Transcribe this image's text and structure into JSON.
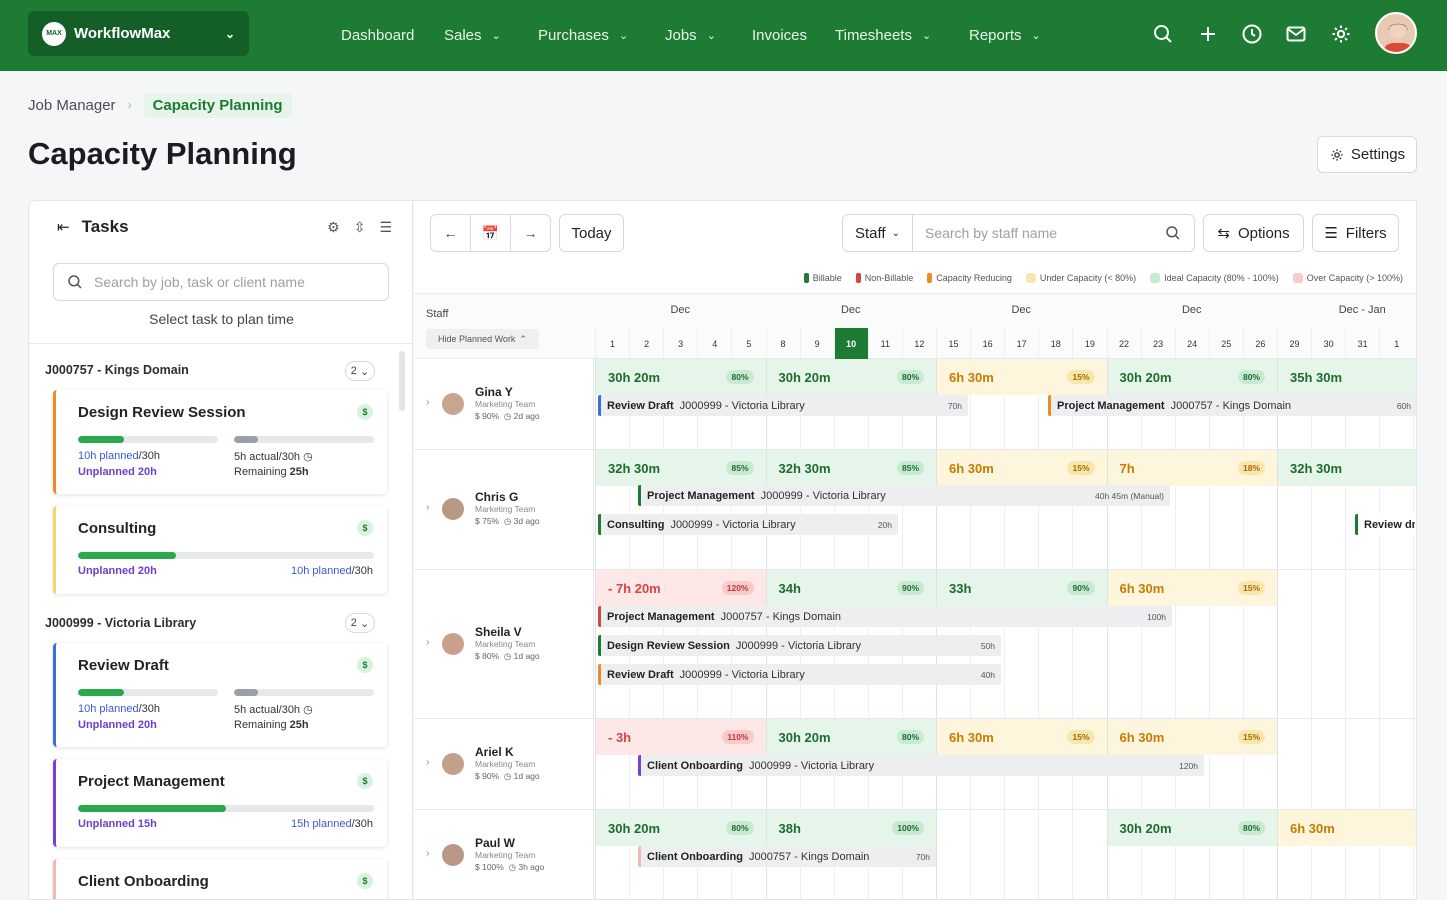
{
  "app": {
    "name": "WorkflowMax",
    "logo": "MAX"
  },
  "nav": [
    {
      "label": "Dashboard",
      "dd": false
    },
    {
      "label": "Sales",
      "dd": true
    },
    {
      "label": "Purchases",
      "dd": true
    },
    {
      "label": "Jobs",
      "dd": true
    },
    {
      "label": "Invoices",
      "dd": false
    },
    {
      "label": "Timesheets",
      "dd": true
    },
    {
      "label": "Reports",
      "dd": true
    }
  ],
  "breadcrumb": {
    "parent": "Job Manager",
    "current": "Capacity Planning"
  },
  "page": {
    "title": "Capacity Planning",
    "settings": "Settings"
  },
  "tasks": {
    "title": "Tasks",
    "search_placeholder": "Search by job, task or client name",
    "hint": "Select task to plan time",
    "groups": [
      {
        "label": "J000757 - Kings Domain",
        "count": "2"
      },
      {
        "label": "J000999 - Victoria Library",
        "count": "2"
      }
    ],
    "cards": [
      {
        "title": "Design Review Session",
        "planned": "10h planned",
        "plannedTotal": "/30h",
        "actual": "5h actual/30h",
        "unplanned": "Unplanned 20h",
        "remaining_label": "Remaining",
        "remaining": "25h",
        "color": "#f08a24",
        "progress": 0.33,
        "actualProgress": 0.17
      },
      {
        "title": "Consulting",
        "unplanned": "Unplanned 20h",
        "planned": "10h planned",
        "plannedTotal": "/30h",
        "color": "#f5d46a",
        "progress": 0.33
      },
      {
        "title": "Review Draft",
        "planned": "10h planned",
        "plannedTotal": "/30h",
        "actual": "5h actual/30h",
        "unplanned": "Unplanned 20h",
        "remaining_label": "Remaining",
        "remaining": "25h",
        "color": "#3a6fe0",
        "progress": 0.33,
        "actualProgress": 0.17
      },
      {
        "title": "Project Management",
        "unplanned": "Unplanned 15h",
        "planned": "15h planned",
        "plannedTotal": "/30h",
        "color": "#7b3fd6",
        "progress": 0.5
      },
      {
        "title": "Client Onboarding",
        "color": "#f5b8b8"
      }
    ]
  },
  "toolbar": {
    "today": "Today",
    "staff": "Staff",
    "staff_placeholder": "Search by staff name",
    "options": "Options",
    "filters": "Filters"
  },
  "legend": [
    {
      "label": "Billable",
      "color": "#1e7b34"
    },
    {
      "label": "Non-Billable",
      "color": "#d64545"
    },
    {
      "label": "Capacity Reducing",
      "color": "#f08a24"
    },
    {
      "label": "Under Capacity (< 80%)",
      "color": "#f7e7ad"
    },
    {
      "label": "Ideal Capacity (80% - 100%)",
      "color": "#c9ead2"
    },
    {
      "label": "Over Capacity (> 100%)",
      "color": "#f8caca"
    }
  ],
  "grid": {
    "staff_header": "Staff",
    "hide_planned": "Hide Planned Work",
    "months": [
      "Dec",
      "Dec",
      "Dec",
      "Dec",
      "Dec - Jan"
    ],
    "days": [
      "1",
      "2",
      "3",
      "4",
      "5",
      "8",
      "9",
      "10",
      "11",
      "12",
      "15",
      "16",
      "17",
      "18",
      "19",
      "22",
      "23",
      "24",
      "25",
      "26",
      "29",
      "30",
      "31",
      "1"
    ],
    "today_index": 7
  },
  "staff": [
    {
      "name": "Gina Y",
      "team": "Marketing Team",
      "rate": "$ 90%",
      "ago": "2d ago",
      "caps": [
        {
          "v": "30h 20m",
          "p": "80%",
          "c": "g"
        },
        {
          "v": "30h 20m",
          "p": "80%",
          "c": "g"
        },
        {
          "v": "6h 30m",
          "p": "15%",
          "c": "y"
        },
        {
          "v": "30h 20m",
          "p": "80%",
          "c": "g"
        },
        {
          "v": "35h 30m",
          "p": "",
          "c": "g"
        }
      ],
      "tasks": [
        {
          "name": "Review Draft",
          "job": "J000999 - Victoria Library",
          "hours": "70h",
          "color": "#3a6fe0"
        },
        {
          "name": "Project Management",
          "job": "J000757 - Kings Domain",
          "hours": "60h",
          "color": "#f08a24"
        }
      ]
    },
    {
      "name": "Chris G",
      "team": "Marketing Team",
      "rate": "$ 75%",
      "ago": "3d ago",
      "caps": [
        {
          "v": "32h 30m",
          "p": "85%",
          "c": "g"
        },
        {
          "v": "32h 30m",
          "p": "85%",
          "c": "g"
        },
        {
          "v": "6h 30m",
          "p": "15%",
          "c": "y"
        },
        {
          "v": "7h",
          "p": "18%",
          "c": "y"
        },
        {
          "v": "32h 30m",
          "p": "",
          "c": "g"
        }
      ],
      "tasks": [
        {
          "name": "Project Management",
          "job": "J000999 - Victoria Library",
          "hours": "40h 45m (Manual)",
          "color": "#1e7b34"
        },
        {
          "name": "Consulting",
          "job": "J000999 - Victoria Library",
          "hours": "20h",
          "color": "#1e7b34"
        },
        {
          "name": "Review dr",
          "job": "",
          "hours": "",
          "color": "#1e7b34"
        }
      ]
    },
    {
      "name": "Sheila V",
      "team": "Marketing Team",
      "rate": "$ 80%",
      "ago": "1d ago",
      "caps": [
        {
          "v": "- 7h 20m",
          "p": "120%",
          "c": "r"
        },
        {
          "v": "34h",
          "p": "90%",
          "c": "g"
        },
        {
          "v": "33h",
          "p": "90%",
          "c": "g"
        },
        {
          "v": "6h 30m",
          "p": "15%",
          "c": "y"
        }
      ],
      "tasks": [
        {
          "name": "Project Management",
          "job": "J000757 - Kings Domain",
          "hours": "100h",
          "color": "#d64545"
        },
        {
          "name": "Design Review Session",
          "job": "J000999 - Victoria Library",
          "hours": "50h",
          "color": "#1e7b34"
        },
        {
          "name": "Review Draft",
          "job": "J000999 - Victoria Library",
          "hours": "40h",
          "color": "#f08a24"
        }
      ]
    },
    {
      "name": "Ariel K",
      "team": "Marketing Team",
      "rate": "$ 90%",
      "ago": "1d ago",
      "caps": [
        {
          "v": "- 3h",
          "p": "110%",
          "c": "r"
        },
        {
          "v": "30h 20m",
          "p": "80%",
          "c": "g"
        },
        {
          "v": "6h 30m",
          "p": "15%",
          "c": "y"
        },
        {
          "v": "6h 30m",
          "p": "15%",
          "c": "y"
        }
      ],
      "tasks": [
        {
          "name": "Client Onboarding",
          "job": "J000999 - Victoria Library",
          "hours": "120h",
          "color": "#7b3fd6"
        }
      ]
    },
    {
      "name": "Paul W",
      "team": "Marketing Team",
      "rate": "$ 100%",
      "ago": "3h ago",
      "caps": [
        {
          "v": "30h 20m",
          "p": "80%",
          "c": "g"
        },
        {
          "v": "38h",
          "p": "100%",
          "c": "g"
        },
        {
          "v": "30h 20m",
          "p": "80%",
          "c": "g"
        },
        {
          "v": "6h 30m",
          "p": "",
          "c": "y"
        }
      ],
      "tasks": [
        {
          "name": "Client Onboarding",
          "job": "J000757 - Kings Domain",
          "hours": "70h",
          "color": "#f5b8b8"
        }
      ]
    }
  ]
}
